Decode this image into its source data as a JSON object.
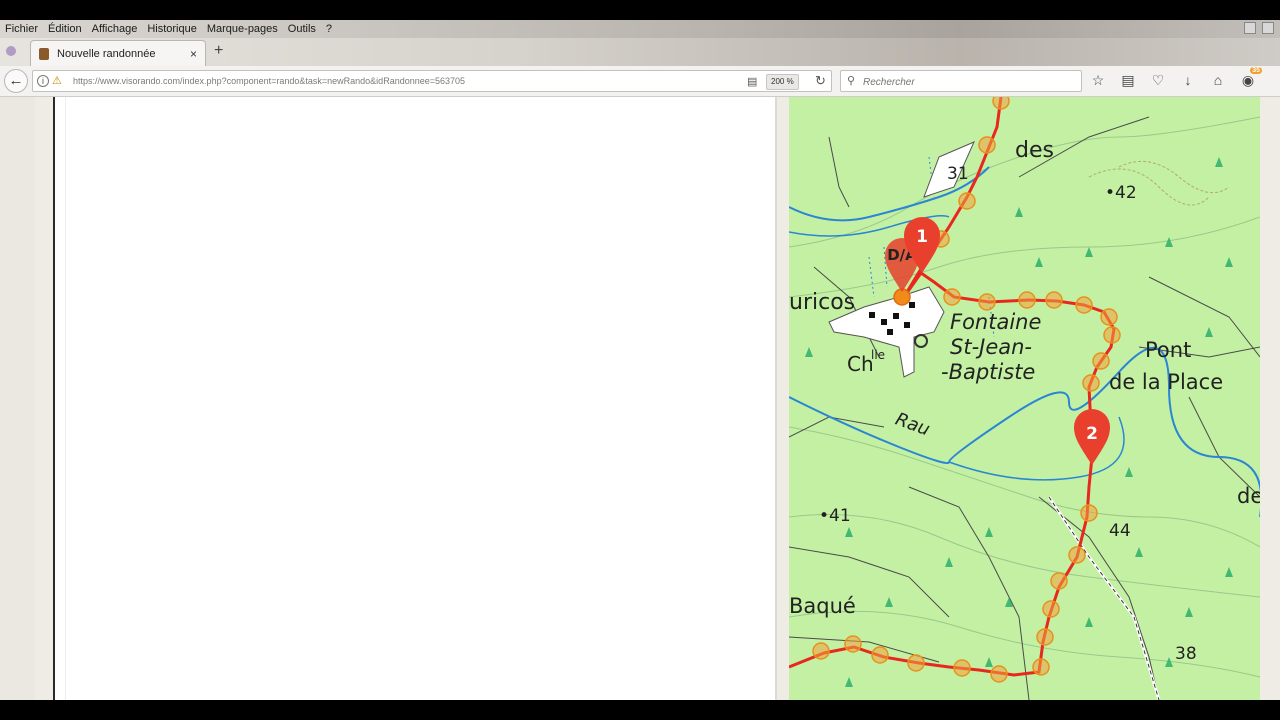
{
  "menu": [
    "Fichier",
    "Édition",
    "Affichage",
    "Historique",
    "Marque-pages",
    "Outils",
    "?"
  ],
  "tab": {
    "title": "Nouvelle randonnée",
    "close": "×",
    "new": "+"
  },
  "nav": {
    "url": "https://www.visorando.com/index.php?component=rando&task=newRando&idRandonnee=563705",
    "zoom": "200 %",
    "search_placeholder": "Rechercher"
  },
  "toolbar": {
    "badge": "35"
  },
  "map": {
    "markers": [
      {
        "label": "1"
      },
      {
        "label": "2"
      }
    ],
    "start_label": "D/A",
    "places": {
      "des": "des",
      "uricos": "uricos",
      "chapel": "Ch",
      "chapel_sup": "lle",
      "fontaine_1": "Fontaine",
      "fontaine_2": "St-Jean-",
      "fontaine_3": "-Baptiste",
      "pont_1": "Pont",
      "pont_2": "de la Place",
      "rau": "Rau",
      "baque": "Baqué",
      "de": "de"
    },
    "elevations": {
      "e31": "31",
      "e42": "•42",
      "e41": "•41",
      "e44": "44",
      "e38": "38"
    },
    "colors": {
      "route": "#e8281e",
      "waypoint": "#f2a13a",
      "map_bg": "#c4f0a4",
      "water": "#2a86d4",
      "marker": "#e8402c"
    }
  }
}
